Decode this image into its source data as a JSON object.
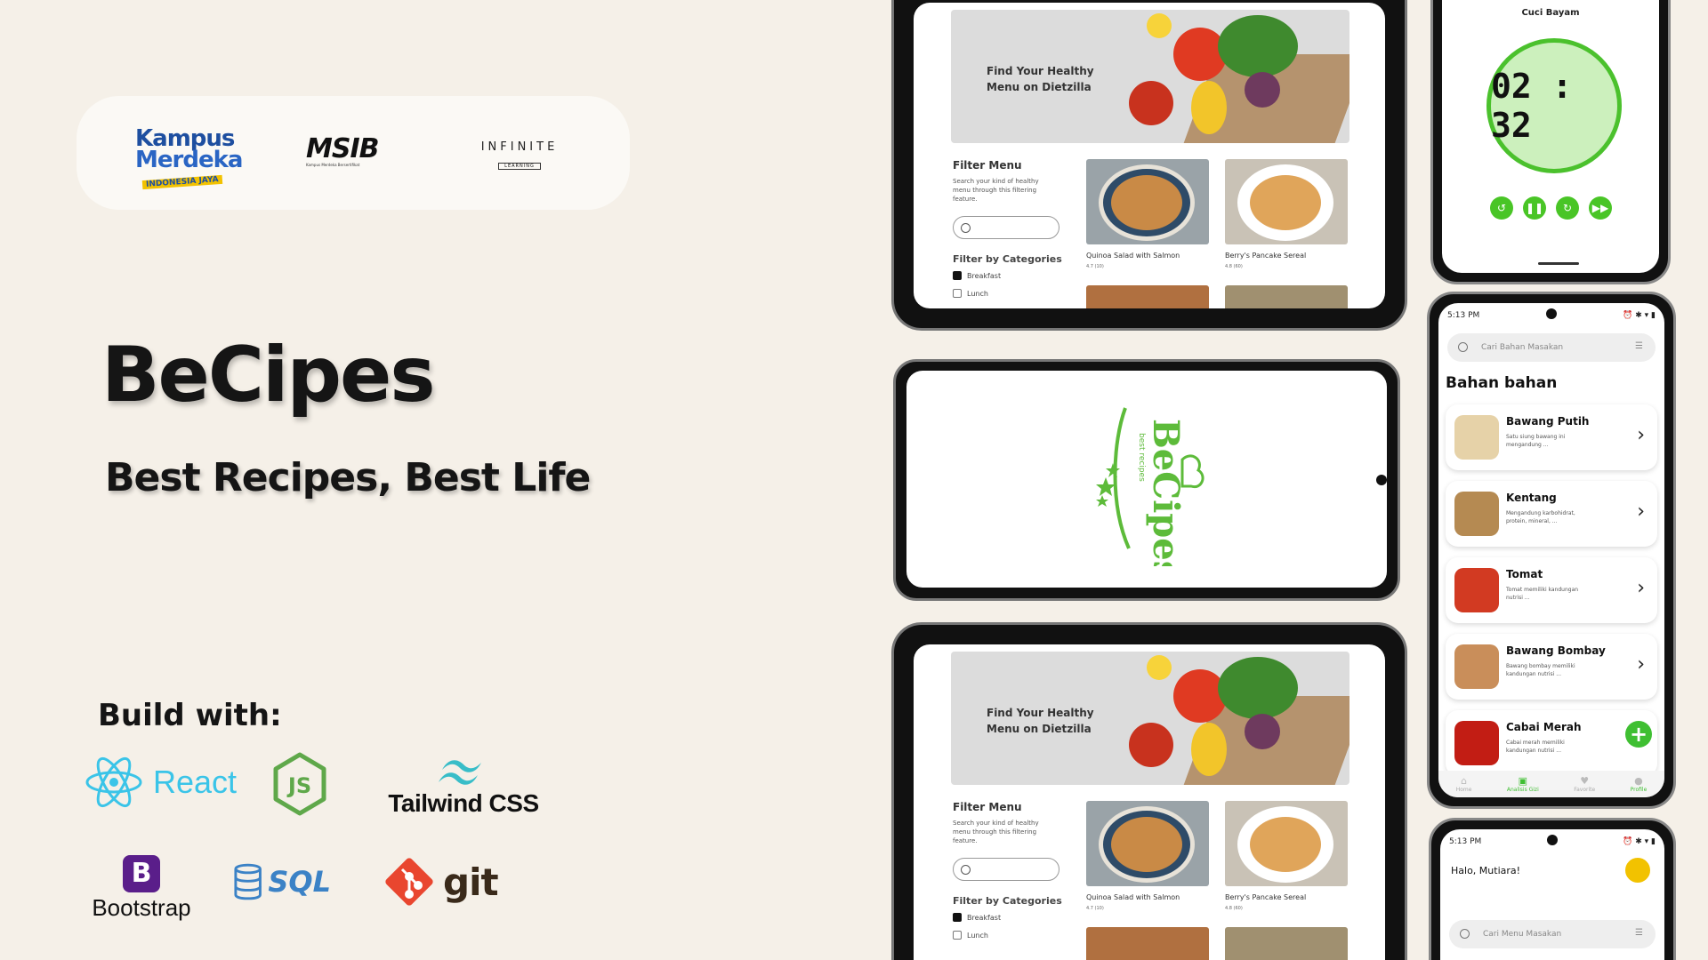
{
  "logos": {
    "kampus_line1": "Kampus",
    "kampus_line2": "Merdeka",
    "kampus_tag": "INDONESIA JAYA",
    "msib": "MSIB",
    "msib_tag": "Kampus Merdeka Bersertifikat",
    "infinite": "INFINITE",
    "infinite_sub": "LEARNING"
  },
  "hero": {
    "title": "BeCipes",
    "subtitle": "Best Recipes, Best Life"
  },
  "build": {
    "label": "Build with:",
    "react": "React",
    "tailwind": "Tailwind CSS",
    "bootstrap": "Bootstrap",
    "bootstrap_mark": "B",
    "sql": "SQL",
    "git": "git"
  },
  "web": {
    "hero_text": "Find Your Healthy Menu on Dietzilla",
    "filter_title": "Filter Menu",
    "filter_desc": "Search your kind of healthy menu through this filtering feature.",
    "categories_title": "Filter by Categories",
    "categories": [
      "Breakfast",
      "Lunch"
    ],
    "cards": [
      {
        "name": "Quinoa Salad with Salmon",
        "rating": "4.7 (10)"
      },
      {
        "name": "Berry's Pancake Sereal",
        "rating": "4.8 (60)"
      }
    ]
  },
  "splash": {
    "logo_text": "BeCipes",
    "logo_sub": "best recipes"
  },
  "timer": {
    "step": "Cuci Bayam",
    "time": "02 : 32"
  },
  "ingredients_screen": {
    "time": "5:13 PM",
    "search_placeholder": "Cari Bahan Masakan",
    "section": "Bahan bahan",
    "items": [
      {
        "name": "Bawang Putih",
        "desc": "Satu siung bawang ini mengandung ..."
      },
      {
        "name": "Kentang",
        "desc": "Mengandung karbohidrat, protein, mineral, ..."
      },
      {
        "name": "Tomat",
        "desc": "Tomat memiliki kandungan nutrisi ..."
      },
      {
        "name": "Bawang Bombay",
        "desc": "Bawang bombay memiliki kandungan nutrisi ..."
      },
      {
        "name": "Cabai Merah",
        "desc": "Cabai merah memiliki kandungan nutrisi ..."
      }
    ],
    "nav": [
      "Home",
      "Analisis Gizi",
      "Favorite",
      "Profile"
    ]
  },
  "home_screen": {
    "time": "5:13 PM",
    "greeting": "Halo, Mutiara!",
    "search_placeholder": "Cari Menu Masakan"
  }
}
